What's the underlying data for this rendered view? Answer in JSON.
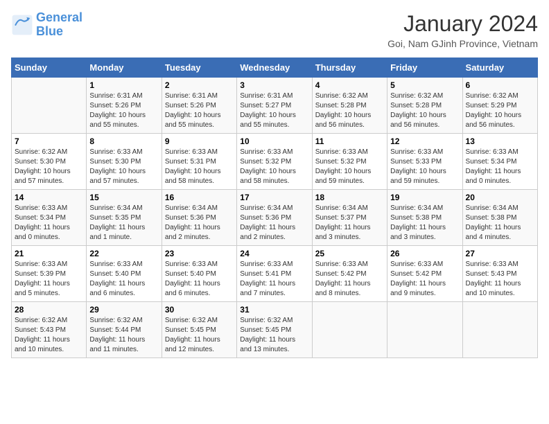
{
  "header": {
    "logo_line1": "General",
    "logo_line2": "Blue",
    "title": "January 2024",
    "subtitle": "Goi, Nam GJinh Province, Vietnam"
  },
  "columns": [
    "Sunday",
    "Monday",
    "Tuesday",
    "Wednesday",
    "Thursday",
    "Friday",
    "Saturday"
  ],
  "weeks": [
    [
      {
        "day": "",
        "info": ""
      },
      {
        "day": "1",
        "info": "Sunrise: 6:31 AM\nSunset: 5:26 PM\nDaylight: 10 hours\nand 55 minutes."
      },
      {
        "day": "2",
        "info": "Sunrise: 6:31 AM\nSunset: 5:26 PM\nDaylight: 10 hours\nand 55 minutes."
      },
      {
        "day": "3",
        "info": "Sunrise: 6:31 AM\nSunset: 5:27 PM\nDaylight: 10 hours\nand 55 minutes."
      },
      {
        "day": "4",
        "info": "Sunrise: 6:32 AM\nSunset: 5:28 PM\nDaylight: 10 hours\nand 56 minutes."
      },
      {
        "day": "5",
        "info": "Sunrise: 6:32 AM\nSunset: 5:28 PM\nDaylight: 10 hours\nand 56 minutes."
      },
      {
        "day": "6",
        "info": "Sunrise: 6:32 AM\nSunset: 5:29 PM\nDaylight: 10 hours\nand 56 minutes."
      }
    ],
    [
      {
        "day": "7",
        "info": "Sunrise: 6:32 AM\nSunset: 5:30 PM\nDaylight: 10 hours\nand 57 minutes."
      },
      {
        "day": "8",
        "info": "Sunrise: 6:33 AM\nSunset: 5:30 PM\nDaylight: 10 hours\nand 57 minutes."
      },
      {
        "day": "9",
        "info": "Sunrise: 6:33 AM\nSunset: 5:31 PM\nDaylight: 10 hours\nand 58 minutes."
      },
      {
        "day": "10",
        "info": "Sunrise: 6:33 AM\nSunset: 5:32 PM\nDaylight: 10 hours\nand 58 minutes."
      },
      {
        "day": "11",
        "info": "Sunrise: 6:33 AM\nSunset: 5:32 PM\nDaylight: 10 hours\nand 59 minutes."
      },
      {
        "day": "12",
        "info": "Sunrise: 6:33 AM\nSunset: 5:33 PM\nDaylight: 10 hours\nand 59 minutes."
      },
      {
        "day": "13",
        "info": "Sunrise: 6:33 AM\nSunset: 5:34 PM\nDaylight: 11 hours\nand 0 minutes."
      }
    ],
    [
      {
        "day": "14",
        "info": "Sunrise: 6:33 AM\nSunset: 5:34 PM\nDaylight: 11 hours\nand 0 minutes."
      },
      {
        "day": "15",
        "info": "Sunrise: 6:34 AM\nSunset: 5:35 PM\nDaylight: 11 hours\nand 1 minute."
      },
      {
        "day": "16",
        "info": "Sunrise: 6:34 AM\nSunset: 5:36 PM\nDaylight: 11 hours\nand 2 minutes."
      },
      {
        "day": "17",
        "info": "Sunrise: 6:34 AM\nSunset: 5:36 PM\nDaylight: 11 hours\nand 2 minutes."
      },
      {
        "day": "18",
        "info": "Sunrise: 6:34 AM\nSunset: 5:37 PM\nDaylight: 11 hours\nand 3 minutes."
      },
      {
        "day": "19",
        "info": "Sunrise: 6:34 AM\nSunset: 5:38 PM\nDaylight: 11 hours\nand 3 minutes."
      },
      {
        "day": "20",
        "info": "Sunrise: 6:34 AM\nSunset: 5:38 PM\nDaylight: 11 hours\nand 4 minutes."
      }
    ],
    [
      {
        "day": "21",
        "info": "Sunrise: 6:33 AM\nSunset: 5:39 PM\nDaylight: 11 hours\nand 5 minutes."
      },
      {
        "day": "22",
        "info": "Sunrise: 6:33 AM\nSunset: 5:40 PM\nDaylight: 11 hours\nand 6 minutes."
      },
      {
        "day": "23",
        "info": "Sunrise: 6:33 AM\nSunset: 5:40 PM\nDaylight: 11 hours\nand 6 minutes."
      },
      {
        "day": "24",
        "info": "Sunrise: 6:33 AM\nSunset: 5:41 PM\nDaylight: 11 hours\nand 7 minutes."
      },
      {
        "day": "25",
        "info": "Sunrise: 6:33 AM\nSunset: 5:42 PM\nDaylight: 11 hours\nand 8 minutes."
      },
      {
        "day": "26",
        "info": "Sunrise: 6:33 AM\nSunset: 5:42 PM\nDaylight: 11 hours\nand 9 minutes."
      },
      {
        "day": "27",
        "info": "Sunrise: 6:33 AM\nSunset: 5:43 PM\nDaylight: 11 hours\nand 10 minutes."
      }
    ],
    [
      {
        "day": "28",
        "info": "Sunrise: 6:32 AM\nSunset: 5:43 PM\nDaylight: 11 hours\nand 10 minutes."
      },
      {
        "day": "29",
        "info": "Sunrise: 6:32 AM\nSunset: 5:44 PM\nDaylight: 11 hours\nand 11 minutes."
      },
      {
        "day": "30",
        "info": "Sunrise: 6:32 AM\nSunset: 5:45 PM\nDaylight: 11 hours\nand 12 minutes."
      },
      {
        "day": "31",
        "info": "Sunrise: 6:32 AM\nSunset: 5:45 PM\nDaylight: 11 hours\nand 13 minutes."
      },
      {
        "day": "",
        "info": ""
      },
      {
        "day": "",
        "info": ""
      },
      {
        "day": "",
        "info": ""
      }
    ]
  ]
}
